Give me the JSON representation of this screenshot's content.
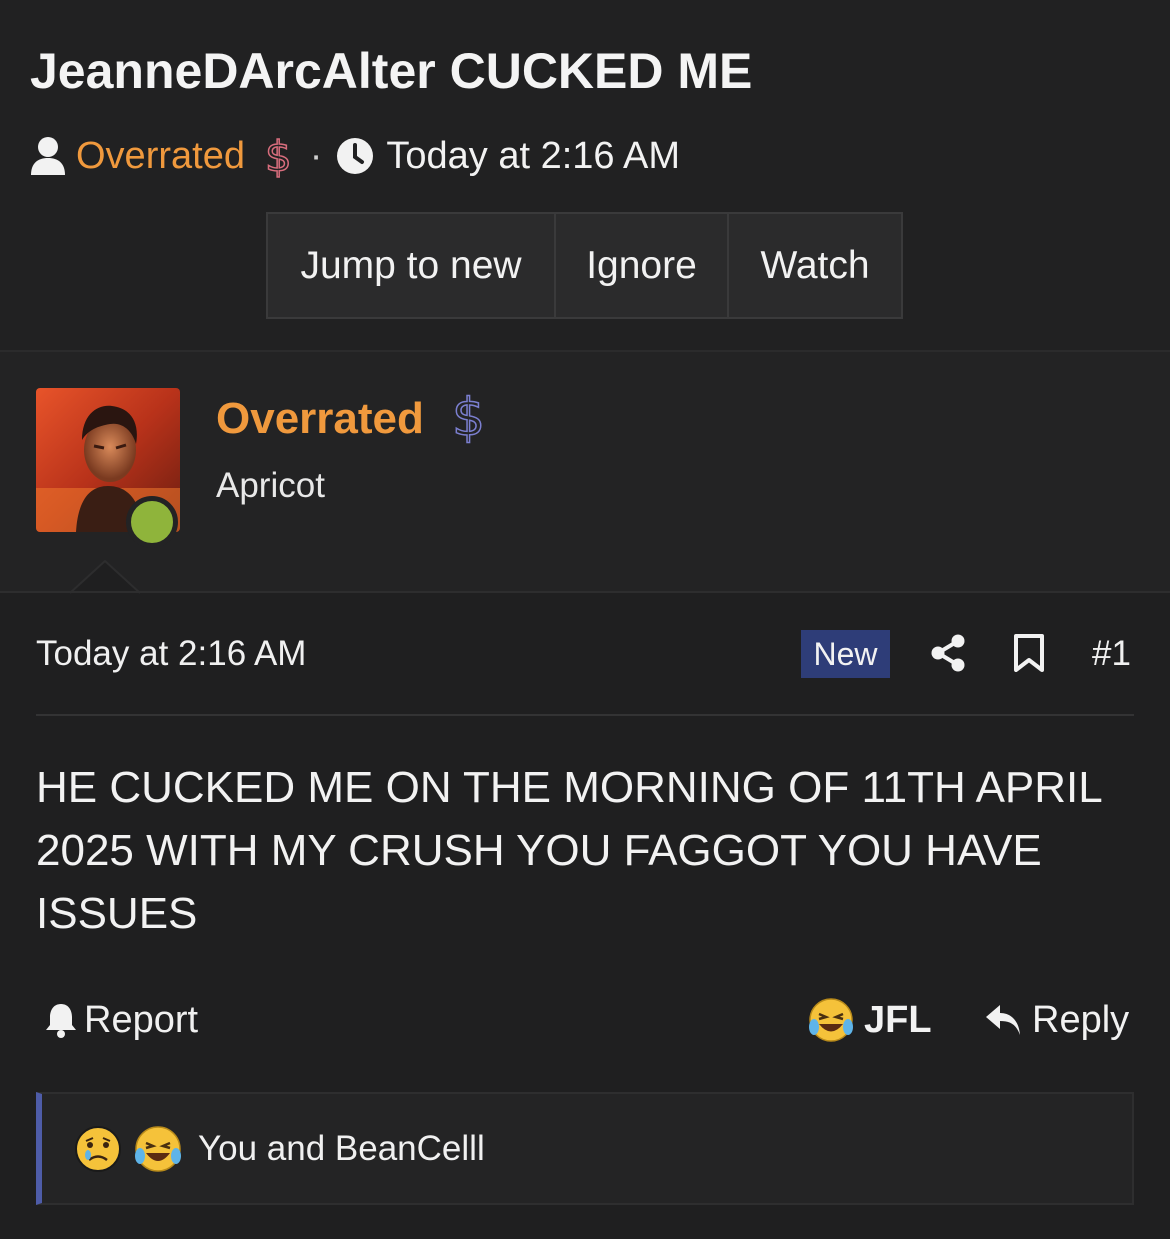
{
  "thread": {
    "title": "JeanneDArcAlter CUCKED ME",
    "author": "Overrated",
    "separator": "·",
    "date": "Today at 2:16 AM"
  },
  "buttons": {
    "jump_to_new": "Jump to new",
    "ignore": "Ignore",
    "watch": "Watch"
  },
  "user": {
    "name": "Overrated",
    "title": "Apricot",
    "status": "online"
  },
  "post": {
    "date": "Today at 2:16 AM",
    "badge": "New",
    "number": "#1",
    "body": "HE CUCKED ME ON THE MORNING OF 11TH APRIL 2025 WITH MY CRUSH YOU FAGGOT YOU HAVE ISSUES"
  },
  "actions": {
    "report": "Report",
    "reaction_label": "JFL",
    "reply": "Reply"
  },
  "reactions": {
    "summary": "You and BeanCelll",
    "emojis": [
      "sad-cry-emoji",
      "laughing-crying-emoji"
    ]
  },
  "icons": {
    "user": "user-icon",
    "premium": "dollar-icon",
    "clock": "clock-icon",
    "share": "share-icon",
    "bookmark": "bookmark-icon",
    "bell": "bell-icon",
    "reply": "reply-arrow-icon"
  },
  "colors": {
    "background": "#1f1f20",
    "username": "#f0993d",
    "new_badge": "#2e3d78",
    "online": "#8fb43b",
    "reaction_bar_accent": "#4e5ca8"
  }
}
